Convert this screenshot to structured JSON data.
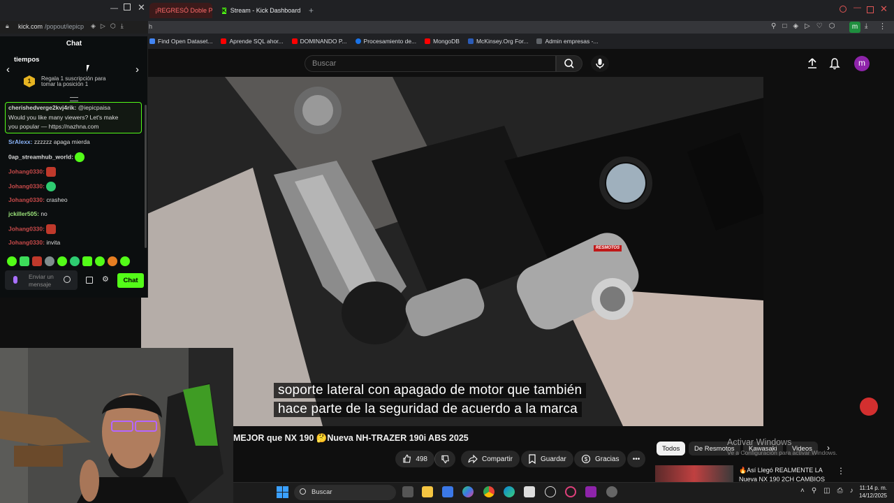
{
  "browser": {
    "tabs": [
      {
        "label": "¡REGRESÓ Doble Pr"
      },
      {
        "label": "Stream - Kick Dashboard"
      }
    ],
    "chat_url_domain": "kick.com",
    "chat_url_path": "/popout/iepicp",
    "address_fragment": "h",
    "bookmarks": [
      {
        "label": "Find Open Dataset...",
        "color": "#4285f4"
      },
      {
        "label": "Aprende SQL ahor...",
        "color": "#ff0000"
      },
      {
        "label": "DOMINANDO P...",
        "color": "#ff0000"
      },
      {
        "label": "Procesamiento de...",
        "color": "#1a73e8"
      },
      {
        "label": "MongoDB",
        "color": "#ff0000"
      },
      {
        "label": "McKinsey.Org For...",
        "color": "#2b5cb8"
      },
      {
        "label": "Admin empresas -...",
        "color": "#5f6368"
      }
    ],
    "profile_letter": "m"
  },
  "youtube": {
    "search_placeholder": "Buscar",
    "avatar_letter": "m",
    "subtitle_line1": "soporte lateral con apagado de motor que también",
    "subtitle_line2": "hace parte de la seguridad de acuerdo a la marca",
    "watermark": "RESMOTOS",
    "title": "MEJOR que NX 190 🤔Nueva NH-TRAZER 190i ABS 2025",
    "likes": "498",
    "share_label": "Compartir",
    "save_label": "Guardar",
    "thanks_label": "Gracias",
    "chips": [
      "Todos",
      "De Resmotos",
      "Kawasaki",
      "Videos"
    ],
    "rec_title_1": "🔥Así Llegó REALMENTE LA",
    "rec_title_2": "Nueva NX 190 2CH CAMBIOS",
    "activate_title": "Activar Windows",
    "activate_sub": "Ve a Configuración para activar Windows."
  },
  "chat": {
    "header": "Chat",
    "subheader": "tiempos",
    "gift_rank": "1",
    "gift_text_1": "Regala 1 suscripción para",
    "gift_text_2": "tomar la posición 1",
    "highlight_user": "cherishedverge2kvj4rik:",
    "highlight_mention": "@iepicpaisa",
    "highlight_text_1": "Would you like many viewers? Let's make",
    "highlight_text_2": "you popular — https://nazhna.com",
    "messages": [
      {
        "user": "SrAlexx:",
        "text": "zzzzzz apaga mierda"
      },
      {
        "user": "0ap_streamhub_world:",
        "text": ""
      },
      {
        "user": "Johang0330:",
        "text": ""
      },
      {
        "user": "Johang0330:",
        "text": ""
      },
      {
        "user": "Johang0330:",
        "text": "crasheo"
      },
      {
        "user": "jckiller505:",
        "text": "no"
      },
      {
        "user": "Johang0330:",
        "text": ""
      },
      {
        "user": "Johang0330:",
        "text": "invita"
      }
    ],
    "input_placeholder_1": "Enviar un",
    "input_placeholder_2": "mensaje",
    "send_label": "Chat",
    "accent": "#53fc18"
  },
  "taskbar": {
    "search_label": "Buscar",
    "time": "11:14 p. m.",
    "date": "14/12/2025"
  }
}
